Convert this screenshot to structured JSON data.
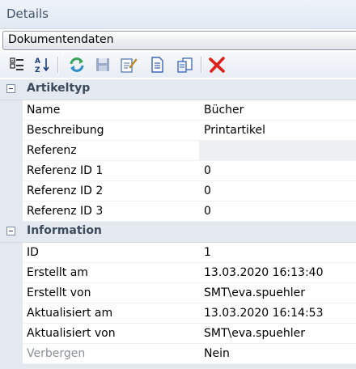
{
  "panel": {
    "title": "Details"
  },
  "object_selector": {
    "selected": "Dokumentendaten"
  },
  "toolbar": {
    "buttons": [
      {
        "icon": "categorized-view-icon"
      },
      {
        "icon": "sort-alphabetical-icon"
      },
      {
        "icon": "refresh-icon"
      },
      {
        "icon": "save-icon"
      },
      {
        "icon": "edit-icon"
      },
      {
        "icon": "document-icon"
      },
      {
        "icon": "copy-document-icon"
      },
      {
        "icon": "delete-icon"
      }
    ]
  },
  "categories": [
    {
      "label": "Artikeltyp",
      "rows": [
        {
          "name": "Name",
          "value": "Bücher"
        },
        {
          "name": "Beschreibung",
          "value": "Printartikel"
        },
        {
          "name": "Referenz",
          "value": ""
        },
        {
          "name": "Referenz ID 1",
          "value": "0"
        },
        {
          "name": "Referenz ID 2",
          "value": "0"
        },
        {
          "name": "Referenz ID 3",
          "value": "0"
        }
      ]
    },
    {
      "label": "Information",
      "rows": [
        {
          "name": "ID",
          "value": "1"
        },
        {
          "name": "Erstellt am",
          "value": "13.03.2020 16:13:40"
        },
        {
          "name": "Erstellt von",
          "value": "SMT\\eva.spuehler"
        },
        {
          "name": "Aktualisiert am",
          "value": "13.03.2020 16:14:53"
        },
        {
          "name": "Aktualisiert von",
          "value": "SMT\\eva.spuehler"
        },
        {
          "name": "Verbergen",
          "value": "Nein"
        }
      ]
    }
  ]
}
